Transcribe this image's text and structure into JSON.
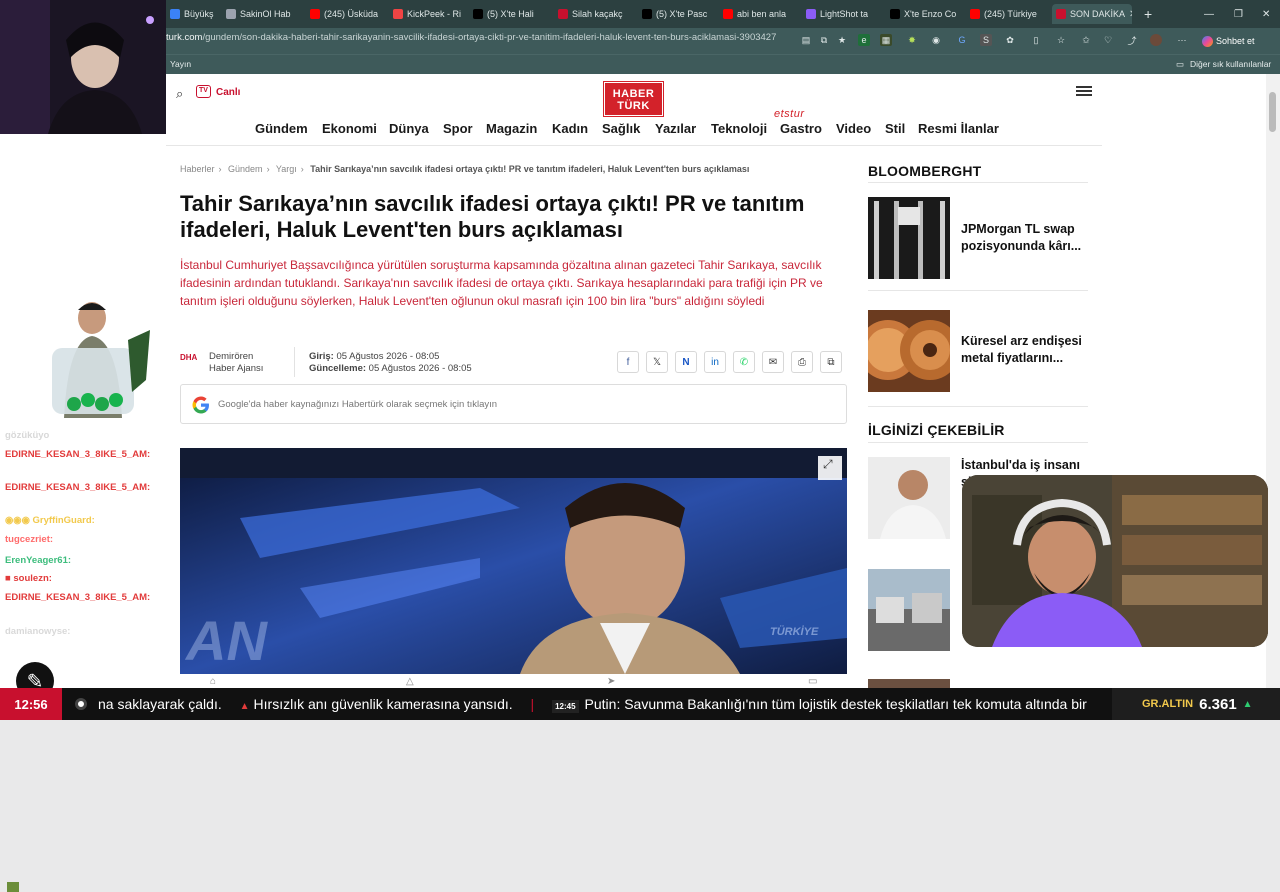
{
  "browser": {
    "tabs": [
      {
        "label": "Büyükş",
        "fav_color": "#3b82f6"
      },
      {
        "label": "SakinOl Hab",
        "fav_color": "#9ca3af"
      },
      {
        "label": "(245) Üsküda",
        "fav_color": "#ff0000"
      },
      {
        "label": "KickPeek - Ri",
        "fav_color": "#ef4444"
      },
      {
        "label": "(5) X'te Hali",
        "fav_color": "#000000"
      },
      {
        "label": "Silah kaçakç",
        "fav_color": "#c8102e"
      },
      {
        "label": "(5) X'te Pasc",
        "fav_color": "#000000"
      },
      {
        "label": "abi ben anla",
        "fav_color": "#ff0000"
      },
      {
        "label": "LightShot ta",
        "fav_color": "#8b5cf6"
      },
      {
        "label": "X'te Enzo Co",
        "fav_color": "#000000"
      },
      {
        "label": "(245) Türkiye",
        "fav_color": "#ff0000"
      },
      {
        "label": "SON DAKİKA",
        "fav_color": "#c8102e"
      }
    ],
    "url_host": "turk.com",
    "url_path": "/gundem/son-dakika-haberi-tahir-sarikayanin-savcilik-ifadesi-ortaya-cikti-pr-ve-tanitim-ifadeleri-haluk-levent-ten-burs-aciklamasi-3903427",
    "sohbet_label": "Sohbet et",
    "bookmarks_left": "Yayın",
    "bookmarks_right": "Diğer sık kullanılanlar"
  },
  "site": {
    "canli_label": "Canlı",
    "tv_label": "TV",
    "logo_line1": "HABER",
    "logo_line2": "TÜRK",
    "etstur": "etstur",
    "nav": [
      "Gündem",
      "Ekonomi",
      "Dünya",
      "Spor",
      "Magazin",
      "Kadın",
      "Sağlık",
      "Yazılar",
      "Teknoloji",
      "Gastro",
      "Video",
      "Stil",
      "Resmi İlanlar"
    ]
  },
  "article": {
    "breadcrumbs": [
      "Haberler",
      "Gündem",
      "Yargı",
      "Tahir Sarıkaya’nın savcılık ifadesi ortaya çıktı! PR ve tanıtım ifadeleri, Haluk Levent'ten burs açıklaması"
    ],
    "title": "Tahir Sarıkaya’nın savcılık ifadesi ortaya çıktı! PR ve tanıtım ifadeleri, Haluk Levent'ten burs açıklaması",
    "lead": "İstanbul Cumhuriyet Başsavcılığınca yürütülen soruşturma kapsamında gözaltına alınan gazeteci Tahir Sarıkaya, savcılık ifadesinin ardından tutuklandı. Sarıkaya'nın savcılık ifadesi de ortaya çıktı. Sarıkaya hesaplarındaki para trafiği için PR ve tanıtım işleri olduğunu söylerken, Haluk Levent'ten oğlunun okul masrafı için 100 bin lira \"burs\" aldığını söyledi",
    "agency_logo": "DHA",
    "author_line1": "Demirören",
    "author_line2": "Haber Ajansı",
    "giris_label": "Giriş:",
    "giris_value": "05 Ağustos 2026 - 08:05",
    "guncelleme_label": "Güncelleme:",
    "guncelleme_value": "05 Ağustos 2026 - 08:05",
    "google_text": "Google'da haber kaynağınızı Habertürk olarak seçmek için tıklayın",
    "hero_overlay_left": "AN",
    "hero_overlay_right": "TÜRKİYE"
  },
  "sidebar": {
    "section1": "BLOOMBERGHT",
    "items1": [
      {
        "title": "JPMorgan TL swap pozisyonunda kârı..."
      },
      {
        "title": "Küresel arz endişesi metal fiyatlarını..."
      }
    ],
    "section2": "İLGİNİZİ ÇEKEBİLİR",
    "items2": [
      {
        "title": "İstanbul'da iş insanı si..."
      },
      {
        "title": ""
      }
    ]
  },
  "chat": [
    {
      "user": "",
      "msg": "gözüküyo",
      "color": "#cfcfcf"
    },
    {
      "user": "EDIRNE_KESAN_3_8IKE_5_AM:",
      "msg": "",
      "color": "#e23b3b"
    },
    {
      "user": "EDIRNE_KESAN_3_8IKE_5_AM:",
      "msg": "",
      "color": "#e23b3b"
    },
    {
      "user": "GryffinGuard:",
      "msg": "",
      "color": "#f2c94c"
    },
    {
      "user": "tugcezriet:",
      "msg": "",
      "color": "#ff6b6b"
    },
    {
      "user": "ErenYeager61:",
      "msg": "",
      "color": "#3dbd7d"
    },
    {
      "user": "soulezn:",
      "msg": "",
      "color": "#e23b3b"
    },
    {
      "user": "EDIRNE_KESAN_3_8IKE_5_AM:",
      "msg": "",
      "color": "#e23b3b"
    },
    {
      "user": "damianowyse:",
      "msg": "",
      "color": "#d9d9d9"
    }
  ],
  "ticker": {
    "time": "12:56",
    "item1": "na saklayarak çaldı.",
    "item2": "Hırsızlık anı güvenlik kamerasına yansıdı.",
    "item3_time": "12:45",
    "item3": "Putin: Savunma Bakanlığı'nın tüm lojistik destek teşkilatları tek komuta altında bir",
    "gold_label": "GR.ALTIN",
    "gold_value": "6.361"
  }
}
